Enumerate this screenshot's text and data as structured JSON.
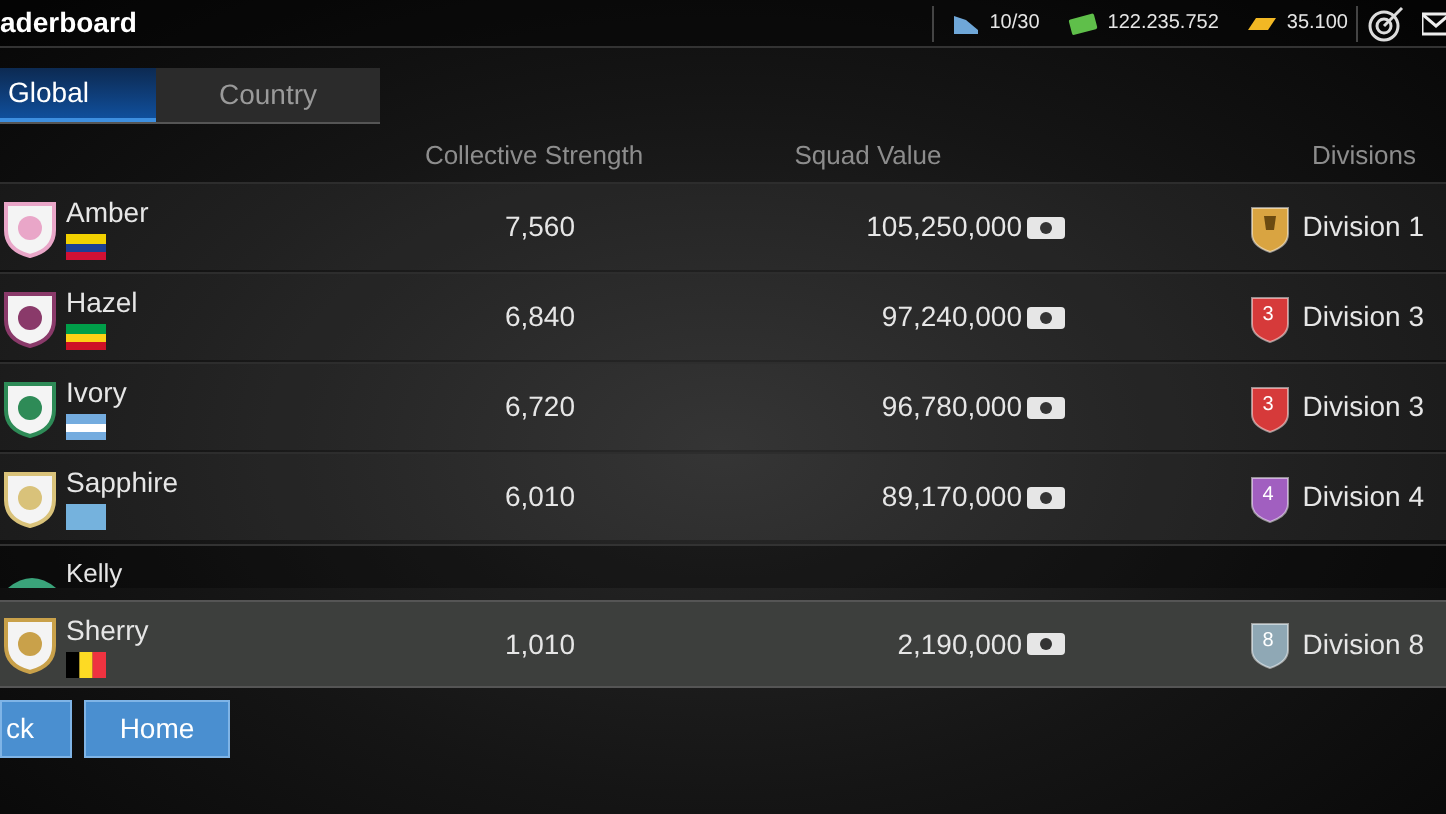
{
  "header": {
    "title": "aderboard",
    "energy": "10/30",
    "cash": "122.235.752",
    "premium": "35.100"
  },
  "tabs": [
    {
      "label": "Global",
      "selected": true
    },
    {
      "label": "Country",
      "selected": false
    }
  ],
  "columns": [
    "Collective Strength",
    "Squad Value",
    "Divisions"
  ],
  "rows": [
    {
      "name": "Amber",
      "strength": "7,560",
      "squad_value": "105,250,000",
      "division": {
        "label": "Division 1",
        "color": "#d9a441"
      },
      "highlight": false
    },
    {
      "name": "Hazel",
      "strength": "6,840",
      "squad_value": "97,240,000",
      "division": {
        "label": "Division 3",
        "badge": "3",
        "color": "#d63a3a"
      },
      "highlight": false
    },
    {
      "name": "Ivory",
      "strength": "6,720",
      "squad_value": "96,780,000",
      "division": {
        "label": "Division 3",
        "badge": "3",
        "color": "#d63a3a"
      },
      "highlight": false
    },
    {
      "name": "Sapphire",
      "strength": "6,010",
      "squad_value": "89,170,000",
      "division": {
        "label": "Division 4",
        "badge": "4",
        "color": "#a15fc0"
      },
      "highlight": false
    },
    {
      "name": "Kelly",
      "highlight": false
    },
    {
      "name": "Sherry",
      "strength": "1,010",
      "squad_value": "2,190,000",
      "division": {
        "label": "Division 8",
        "badge": "8",
        "color": "#8fa8b5"
      },
      "highlight": true
    }
  ],
  "buttons": [
    "ck",
    "Home"
  ]
}
